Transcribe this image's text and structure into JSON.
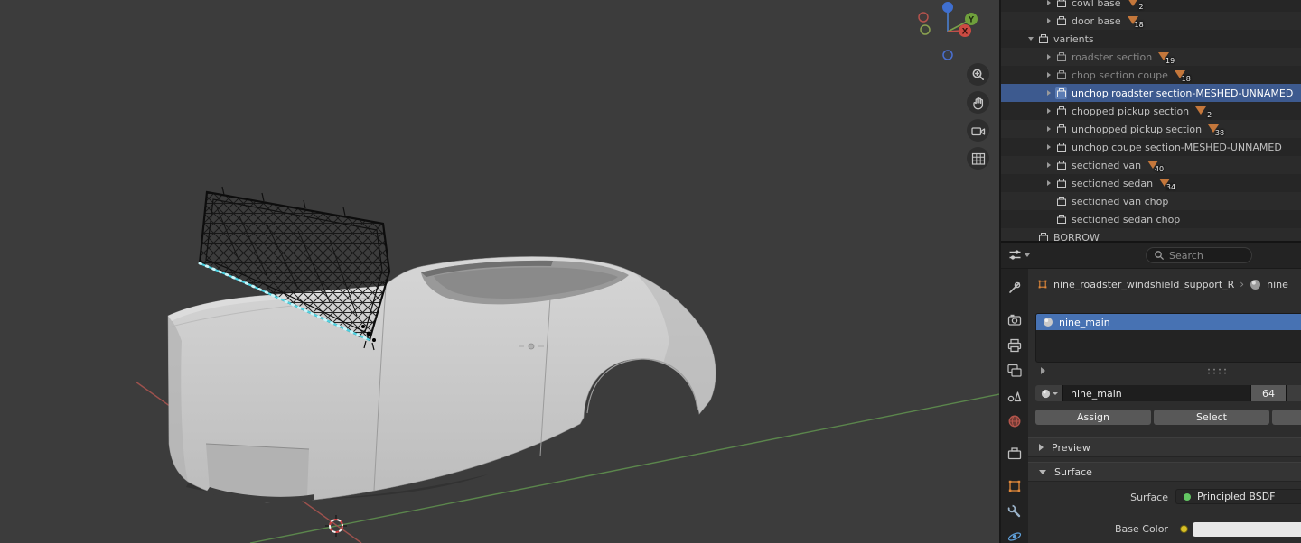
{
  "viewport": {
    "gizmo": {
      "x_label": "X",
      "y_label": "Y"
    }
  },
  "outliner": {
    "rows": [
      {
        "label": "cowl base",
        "badge": "2"
      },
      {
        "label": "door base",
        "badge": "18"
      },
      {
        "label": "varients",
        "badge": ""
      },
      {
        "label": "roadster section",
        "badge": "19"
      },
      {
        "label": "chop section coupe",
        "badge": "18"
      },
      {
        "label": "unchop roadster section-MESHED-UNNAMED",
        "badge": ""
      },
      {
        "label": "chopped pickup section",
        "badge": "2"
      },
      {
        "label": "unchopped pickup section",
        "badge": "38"
      },
      {
        "label": "unchop coupe section-MESHED-UNNAMED",
        "badge": ""
      },
      {
        "label": "sectioned van",
        "badge": "40"
      },
      {
        "label": "sectioned sedan",
        "badge": "34"
      },
      {
        "label": "sectioned van chop",
        "badge": ""
      },
      {
        "label": "sectioned sedan chop",
        "badge": ""
      },
      {
        "label": "BORROW",
        "badge": ""
      }
    ]
  },
  "properties": {
    "search_placeholder": "Search",
    "breadcrumb": {
      "object": "nine_roadster_windshield_support_R",
      "material": "nine"
    },
    "slot": {
      "name": "nine_main"
    },
    "material": {
      "name": "nine_main",
      "users": "64"
    },
    "buttons": {
      "assign": "Assign",
      "select": "Select"
    },
    "panels": {
      "preview": "Preview",
      "surface": "Surface"
    },
    "surface": {
      "label": "Surface",
      "shader": "Principled BSDF",
      "base_color_label": "Base Color"
    }
  },
  "colors": {
    "selection_blue": "#4772b3",
    "outliner_selection": "#3d5a8f",
    "mesh_badge_orange": "#c4773b",
    "object_orange": "#e0883a",
    "shader_socket_green": "#63c763",
    "color_socket_yellow": "#d8c027",
    "axis_x_red": "#a8544f",
    "axis_y_green": "#5f8f4e",
    "selected_edge_cyan": "#4fd3e3",
    "base_color_value": "#e8e8e8"
  }
}
